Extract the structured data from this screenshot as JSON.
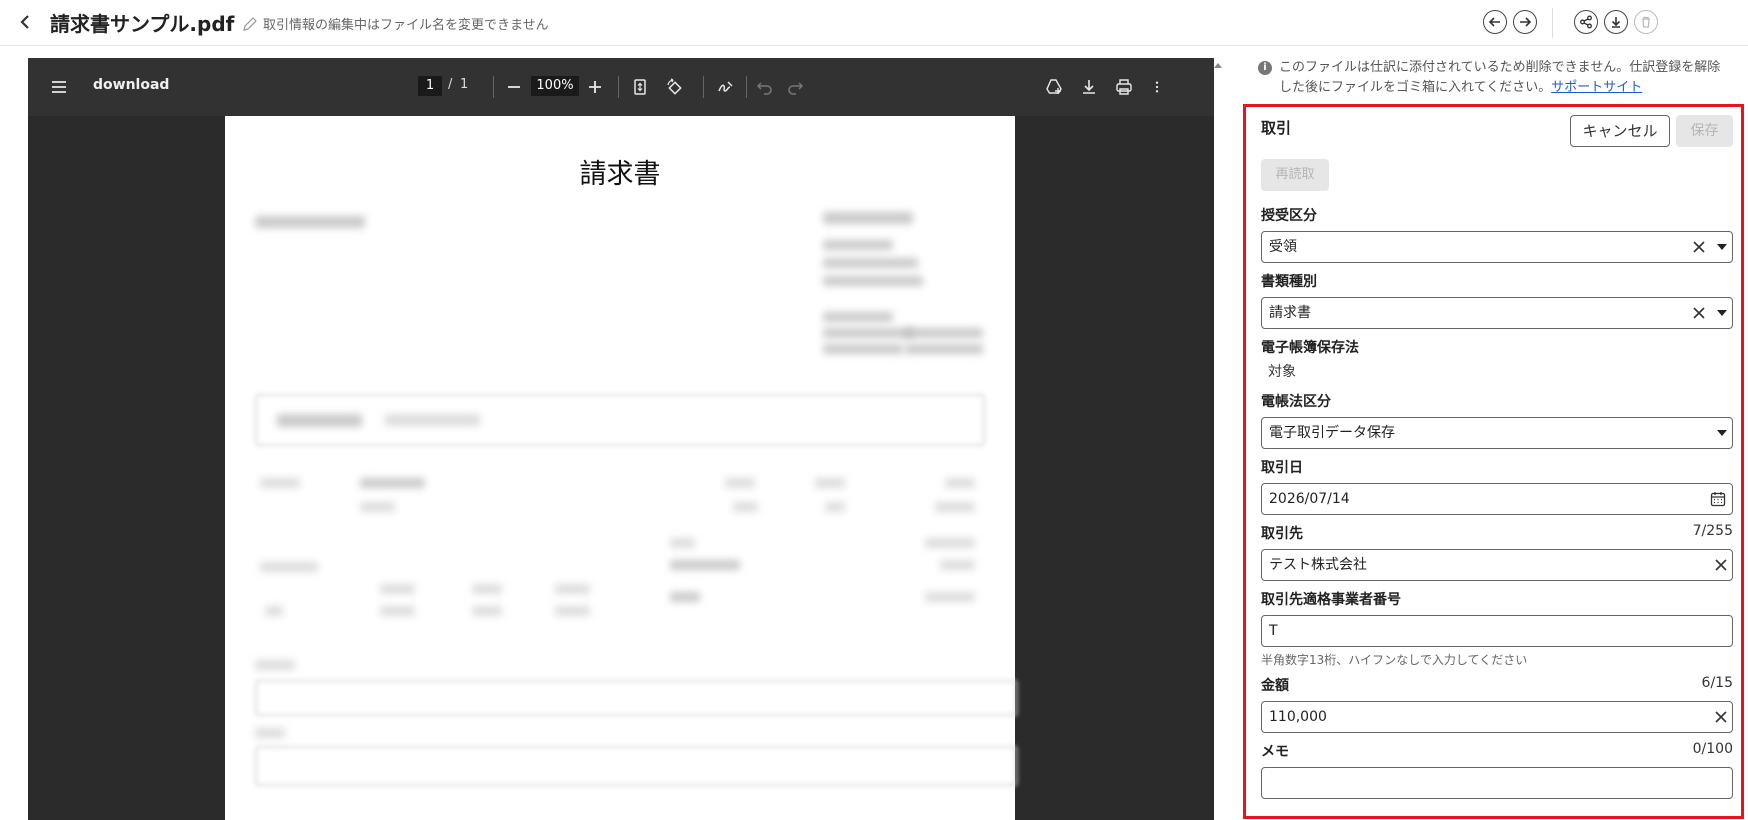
{
  "header": {
    "title": "請求書サンプル.pdf",
    "rename_note": "取引情報の編集中はファイル名を変更できません"
  },
  "viewer": {
    "doc_title": "download",
    "current_page": "1",
    "page_sep": "/",
    "total_pages": "1",
    "zoom": "100%",
    "page_heading": "請求書"
  },
  "notice": {
    "text": "このファイルは仕訳に添付されているため削除できません。仕訳登録を解除した後にファイルをゴミ箱に入れてください。",
    "link": "サポートサイト"
  },
  "form": {
    "section_title": "取引",
    "cancel_label": "キャンセル",
    "save_label": "保存",
    "reread_label": "再読取",
    "fields": {
      "direction": {
        "label": "授受区分",
        "value": "受領"
      },
      "doc_type": {
        "label": "書類種別",
        "value": "請求書"
      },
      "ebook": {
        "label": "電子帳簿保存法",
        "value": "対象"
      },
      "ebook_class": {
        "label": "電帳法区分",
        "value": "電子取引データ保存"
      },
      "date": {
        "label": "取引日",
        "value": "2026/07/14"
      },
      "partner": {
        "label": "取引先",
        "value": "テスト株式会社",
        "count": "7/255"
      },
      "invoice_no": {
        "label": "取引先適格事業者番号",
        "value": "T",
        "hint": "半角数字13桁、ハイフンなしで入力してください"
      },
      "amount": {
        "label": "金額",
        "value": "110,000",
        "count": "6/15"
      },
      "memo": {
        "label": "メモ",
        "value": "",
        "count": "0/100"
      }
    }
  },
  "colors": {
    "highlight": "#e8141c",
    "link": "#1a5fd0",
    "viewer_bg": "#2b2b2b",
    "toolbar_bg": "#323232"
  }
}
